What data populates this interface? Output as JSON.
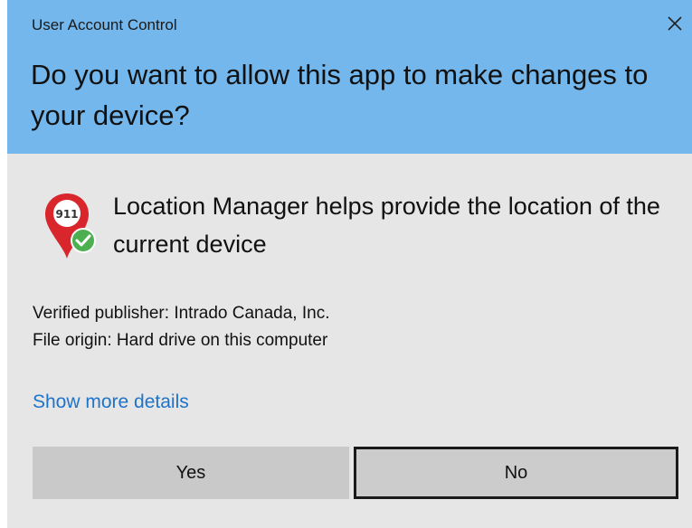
{
  "window": {
    "title": "User Account Control",
    "close_icon": "close-icon"
  },
  "header": {
    "question": "Do you want to allow this app to make changes to your device?",
    "background": "#74b7ec"
  },
  "app": {
    "icon": "location-pin-911-verified-icon",
    "icon_text": "911",
    "description": "Location Manager helps provide the location of the current device"
  },
  "info": {
    "publisher": "Verified publisher: Intrado Canada, Inc.",
    "origin": "File origin: Hard drive on this computer"
  },
  "details_link": "Show more details",
  "buttons": {
    "yes": "Yes",
    "no": "No"
  },
  "colors": {
    "body_background": "#e6e6e6",
    "link": "#1f73c9",
    "pin_red": "#d9262c",
    "check_green": "#4caf50"
  }
}
